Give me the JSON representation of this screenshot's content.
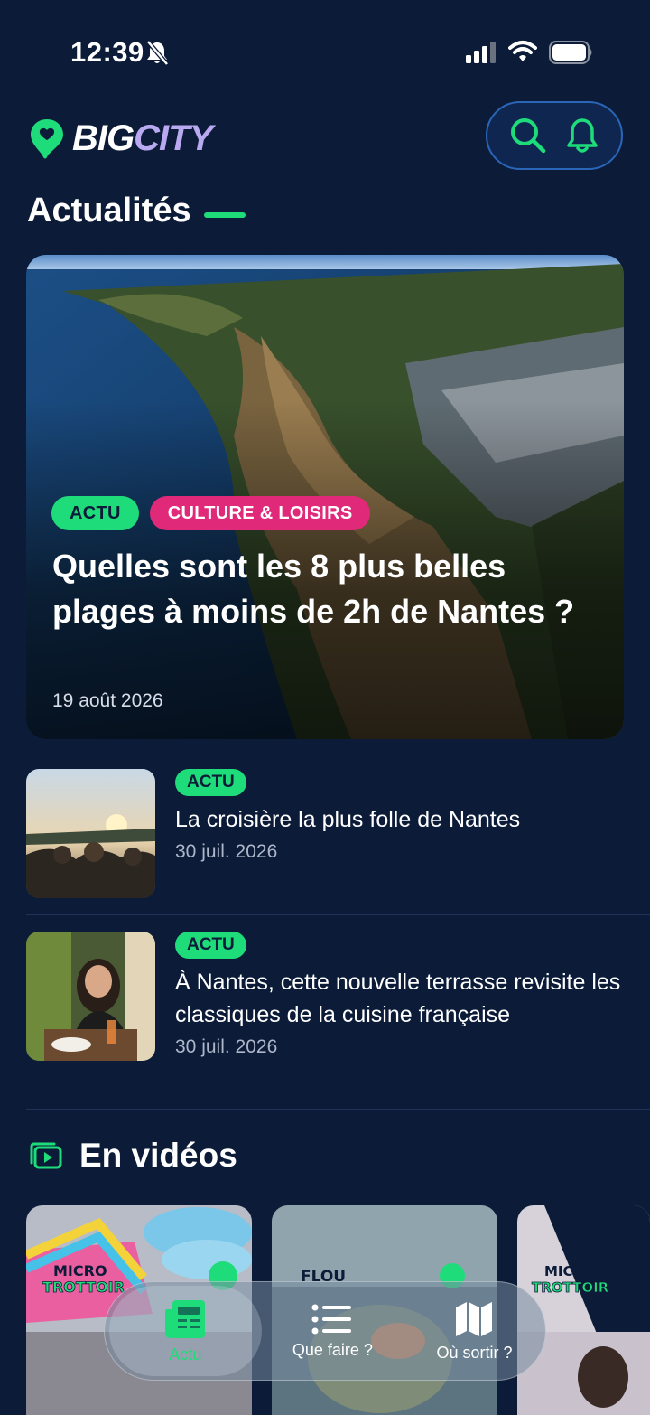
{
  "status_bar": {
    "time": "12:39"
  },
  "header": {
    "logo_big": "BIG",
    "logo_city": "CITY"
  },
  "section": {
    "title": "Actualités"
  },
  "hero": {
    "tags": [
      "ACTU",
      "CULTURE & LOISIRS"
    ],
    "title": "Quelles sont les 8 plus belles plages à moins de 2h de Nantes ?",
    "date": "19 août 2026"
  },
  "articles": [
    {
      "tag": "ACTU",
      "title": "La croisière la plus folle de Nantes",
      "date": "30 juil. 2026"
    },
    {
      "tag": "ACTU",
      "title": "À Nantes, cette nouvelle terrasse revisite les classiques de la cuisine française",
      "date": "30 juil. 2026"
    }
  ],
  "videos": {
    "title": "En vidéos",
    "cards": [
      {
        "label_line1": "MICRO",
        "label_line2": "TROTTOIR"
      },
      {
        "label_line1": "FLOU",
        "label_line2": ""
      },
      {
        "label_line1": "MICRO",
        "label_line2": "TROTTOIR"
      }
    ]
  },
  "bottom_nav": [
    {
      "label": "Actu",
      "icon": "newspaper-icon",
      "active": true
    },
    {
      "label": "Que faire ?",
      "icon": "list-icon",
      "active": false
    },
    {
      "label": "Où sortir ?",
      "icon": "map-icon",
      "active": false
    }
  ],
  "colors": {
    "background": "#0b1b38",
    "accent_green": "#1fdc7a",
    "tag_pink": "#e1297a",
    "logo_city": "#b9a9f0"
  }
}
